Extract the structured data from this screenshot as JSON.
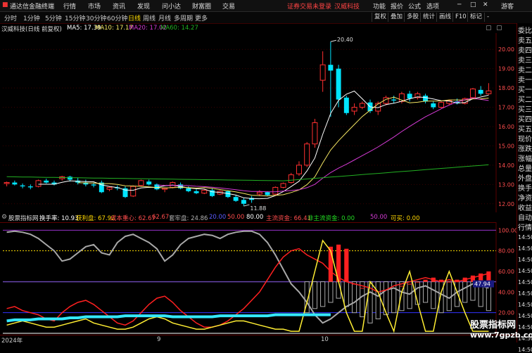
{
  "menubar": {
    "logo": "通达信金融终端",
    "items": [
      "行情",
      "市场",
      "资讯",
      "发现",
      "问小达",
      "财富圈",
      "交易"
    ],
    "notice": "证券交易未登录",
    "stock": "汉威科技",
    "right": [
      "功能",
      "报价",
      "公式",
      "选项"
    ],
    "guest": "游客"
  },
  "toolbar": {
    "periods": [
      "分时",
      "1分钟",
      "5分钟",
      "15分钟",
      "30分钟",
      "60分钟",
      "日线",
      "周线",
      "月线",
      "多周期",
      "更多"
    ],
    "active": "日线",
    "right": [
      "复权",
      "叠加",
      "多股",
      "统计",
      "画线",
      "F10",
      "标记",
      "-"
    ]
  },
  "chart_header": {
    "title": "汉威科技(日线 前复权)",
    "ma": [
      {
        "label": "MA5: 17.39",
        "color": "#ffffff"
      },
      {
        "label": "MA10: 17.17",
        "color": "#f5e663"
      },
      {
        "label": "MA20: 17.02",
        "color": "#d63bd6"
      },
      {
        "label": "MA60: 14.27",
        "color": "#22b022"
      }
    ]
  },
  "chart_data": [
    {
      "type": "candlestick",
      "y_ticks": [
        20.0,
        19.0,
        18.0,
        17.0,
        16.0,
        15.0,
        14.0,
        13.0,
        12.0
      ],
      "ylim": [
        11.7,
        20.7
      ],
      "annotations": [
        {
          "label": "20.40",
          "value": 20.4
        },
        {
          "label": "11.88",
          "value": 11.88
        }
      ],
      "candles": [
        [
          13.05,
          13.15,
          12.9,
          13.1
        ],
        [
          13.1,
          13.2,
          12.95,
          13.0
        ],
        [
          12.95,
          13.05,
          12.8,
          12.9
        ],
        [
          12.9,
          13.0,
          12.75,
          12.85
        ],
        [
          12.9,
          13.25,
          12.85,
          13.2
        ],
        [
          13.2,
          13.3,
          13.05,
          13.1
        ],
        [
          13.1,
          13.2,
          12.95,
          13.0
        ],
        [
          13.3,
          13.45,
          13.2,
          13.4
        ],
        [
          13.4,
          13.45,
          13.15,
          13.25
        ],
        [
          13.2,
          13.35,
          13.0,
          13.1
        ],
        [
          13.1,
          13.25,
          12.9,
          13.0
        ],
        [
          13.0,
          13.1,
          12.85,
          12.95
        ],
        [
          13.1,
          13.2,
          12.55,
          12.6
        ],
        [
          12.75,
          12.9,
          12.65,
          12.85
        ],
        [
          12.85,
          12.95,
          12.7,
          12.8
        ],
        [
          12.8,
          12.9,
          12.3,
          12.35
        ],
        [
          12.4,
          12.95,
          12.35,
          12.9
        ],
        [
          12.95,
          13.25,
          12.9,
          13.2
        ],
        [
          13.15,
          13.25,
          12.95,
          13.0
        ],
        [
          13.0,
          13.05,
          12.7,
          12.75
        ],
        [
          12.75,
          12.85,
          12.6,
          12.8
        ],
        [
          12.85,
          13.15,
          12.8,
          13.1
        ],
        [
          13.0,
          13.1,
          12.75,
          12.8
        ],
        [
          12.8,
          12.9,
          12.6,
          12.65
        ],
        [
          12.65,
          12.75,
          12.5,
          12.55
        ],
        [
          12.55,
          12.75,
          12.5,
          12.7
        ],
        [
          12.7,
          12.8,
          12.35,
          12.4
        ],
        [
          12.5,
          12.7,
          12.45,
          12.65
        ],
        [
          12.65,
          12.7,
          12.3,
          12.35
        ],
        [
          12.35,
          12.45,
          12.1,
          12.15
        ],
        [
          12.2,
          12.3,
          11.88,
          12.0
        ],
        [
          12.3,
          12.4,
          12.05,
          12.2
        ],
        [
          12.5,
          12.7,
          12.4,
          12.6
        ],
        [
          12.6,
          12.65,
          12.4,
          12.45
        ],
        [
          12.5,
          12.9,
          12.45,
          12.85
        ],
        [
          12.85,
          13.1,
          12.8,
          13.05
        ],
        [
          13.1,
          13.6,
          13.05,
          13.5
        ],
        [
          13.55,
          14.2,
          13.45,
          14.0
        ],
        [
          14.0,
          15.2,
          13.9,
          15.1
        ],
        [
          15.1,
          16.4,
          14.9,
          16.2
        ],
        [
          18.4,
          19.9,
          17.8,
          19.2
        ],
        [
          19.2,
          20.4,
          16.5,
          18.9
        ],
        [
          19.0,
          19.2,
          17.0,
          17.4
        ],
        [
          17.5,
          17.6,
          16.6,
          16.7
        ],
        [
          16.8,
          17.2,
          16.6,
          17.0
        ],
        [
          17.0,
          17.3,
          16.9,
          17.2
        ],
        [
          17.25,
          17.4,
          16.7,
          16.8
        ],
        [
          16.8,
          17.3,
          16.6,
          17.2
        ],
        [
          17.2,
          17.6,
          17.1,
          17.5
        ],
        [
          17.4,
          17.6,
          17.2,
          17.35
        ],
        [
          17.3,
          17.8,
          17.2,
          17.7
        ],
        [
          17.7,
          17.85,
          17.3,
          17.45
        ],
        [
          17.5,
          17.8,
          17.4,
          17.7
        ],
        [
          17.6,
          17.7,
          17.2,
          17.3
        ],
        [
          17.2,
          17.3,
          16.9,
          17.0
        ],
        [
          17.0,
          17.3,
          16.95,
          17.25
        ],
        [
          17.2,
          17.4,
          17.1,
          17.35
        ],
        [
          17.3,
          17.45,
          17.15,
          17.2
        ],
        [
          17.2,
          17.5,
          17.15,
          17.45
        ],
        [
          17.5,
          18.0,
          17.45,
          17.95
        ],
        [
          17.9,
          18.1,
          17.6,
          17.7
        ],
        [
          17.7,
          18.25,
          17.65,
          17.85
        ]
      ]
    },
    {
      "type": "indicator",
      "y_ticks": [
        100.0,
        80.0,
        60.0,
        40.0,
        20.0
      ],
      "ylim": [
        0,
        105
      ],
      "current_label": "47.94",
      "gray_line": [
        98,
        99,
        98,
        96,
        92,
        86,
        80,
        70,
        72,
        78,
        84,
        86,
        78,
        76,
        88,
        94,
        96,
        92,
        88,
        82,
        70,
        76,
        86,
        92,
        94,
        96,
        95,
        92,
        96,
        98,
        99,
        99,
        96,
        88,
        76,
        62,
        48,
        40,
        30,
        18,
        10,
        14,
        20,
        26,
        30,
        36,
        40,
        36,
        42,
        44,
        40,
        38,
        44,
        46,
        42,
        38,
        34,
        40,
        44,
        48,
        46,
        44
      ],
      "red_line": [
        24,
        26,
        22,
        20,
        18,
        14,
        12,
        20,
        26,
        30,
        32,
        28,
        22,
        16,
        10,
        8,
        12,
        20,
        28,
        34,
        36,
        30,
        22,
        16,
        10,
        6,
        6,
        8,
        12,
        18,
        24,
        32,
        40,
        52,
        64,
        74,
        80,
        82,
        76,
        72,
        68,
        60,
        54,
        50,
        48,
        46,
        44,
        40,
        42,
        46,
        48,
        50,
        52,
        54,
        52,
        50,
        52,
        50,
        52,
        54,
        56,
        58
      ],
      "yellow_line": [
        8,
        10,
        12,
        10,
        8,
        6,
        6,
        8,
        10,
        12,
        14,
        10,
        8,
        6,
        4,
        4,
        6,
        10,
        14,
        16,
        14,
        10,
        8,
        6,
        4,
        4,
        6,
        8,
        10,
        12,
        12,
        10,
        8,
        6,
        4,
        4,
        2,
        2,
        30,
        60,
        90,
        80,
        50,
        20,
        2,
        2,
        50,
        40,
        20,
        2,
        40,
        60,
        30,
        2,
        2,
        40,
        60,
        40,
        20,
        2,
        2,
        2
      ],
      "cyan_line": [
        12,
        13,
        13,
        13,
        14,
        14,
        14,
        14,
        15,
        15,
        16,
        16,
        16,
        16,
        16,
        17,
        17,
        17,
        17,
        17,
        17,
        16,
        16,
        16,
        16,
        16,
        16,
        17,
        17,
        17,
        17,
        17,
        17,
        17,
        18,
        18,
        18,
        18,
        18,
        18,
        18,
        18,
        null,
        null,
        null,
        null,
        null,
        null,
        null,
        null,
        null,
        null,
        null,
        null,
        null,
        null,
        null,
        null,
        null,
        null,
        null,
        null
      ],
      "red_bars": [
        0,
        0,
        0,
        0,
        0,
        0,
        0,
        0,
        0,
        0,
        0,
        0,
        0,
        0,
        0,
        0,
        0,
        0,
        0,
        0,
        0,
        0,
        0,
        0,
        0,
        0,
        0,
        0,
        0,
        0,
        0,
        0,
        0,
        0,
        0,
        0,
        0,
        0,
        0,
        0,
        0,
        84,
        86,
        82,
        48,
        44,
        0,
        0,
        0,
        44,
        46,
        48,
        50,
        52,
        54,
        52,
        50,
        52,
        54,
        56,
        58,
        60
      ],
      "gray_bars": [
        0,
        0,
        0,
        0,
        0,
        0,
        0,
        0,
        0,
        0,
        0,
        0,
        0,
        0,
        0,
        0,
        0,
        0,
        0,
        0,
        0,
        0,
        0,
        0,
        0,
        0,
        0,
        0,
        0,
        0,
        0,
        0,
        0,
        0,
        0,
        0,
        0,
        0,
        30,
        26,
        24,
        20,
        16,
        24,
        30,
        34,
        40,
        36,
        32,
        30,
        28,
        26,
        22,
        20,
        26,
        30,
        28,
        24,
        20,
        18,
        24,
        28
      ]
    }
  ],
  "indicator_header": {
    "name": "股票指标网",
    "items": [
      {
        "label": "换手率: 10.93",
        "color": "#ffffff"
      },
      {
        "label": "获利盘: 67.92",
        "color": "#ffd700"
      },
      {
        "label": "成本重心: 62.67",
        "color": "#ff4d4d"
      },
      {
        "label": "62.67",
        "color": "#ff4d4d"
      },
      {
        "label": "套牢盘: 24.86",
        "color": "#b0b0b0"
      },
      {
        "label": "20.00",
        "color": "#5a5aff"
      },
      {
        "label": "50.00",
        "color": "#ff4d4d"
      },
      {
        "label": "80.00",
        "color": "#ffffff"
      },
      {
        "label": "主流资金: 66.41",
        "color": "#ff4d4d"
      },
      {
        "label": "非主流资金: 0.00",
        "color": "#22dd22"
      },
      {
        "label": "50.00",
        "color": "#d63bd6"
      },
      {
        "label": "可买: 0.00",
        "color": "#ffd700"
      }
    ]
  },
  "date_axis": [
    {
      "label": "2024年"
    },
    {
      "label": "9"
    },
    {
      "label": "10"
    }
  ],
  "right_panel": {
    "labels": [
      "委比",
      "卖五",
      "卖四",
      "卖三",
      "卖二",
      "卖一",
      "买一",
      "买二",
      "买三",
      "买四",
      "买五",
      "现价",
      "涨跌",
      "涨幅",
      "总量",
      "外盘",
      "换手",
      "净资",
      "收益",
      "自动",
      "行情",
      "14:50",
      "14:50",
      "14:50",
      "14:50",
      "14:50",
      "14:50",
      "14:50",
      "14:50",
      "14:50",
      "14:50",
      "14:50"
    ]
  },
  "watermark": {
    "line1": "股票指标网",
    "line2": "www.7gpzb.com"
  },
  "colors": {
    "up": "#ff3030",
    "down": "#00e5ff",
    "price_axis": "#ff4d4d"
  }
}
